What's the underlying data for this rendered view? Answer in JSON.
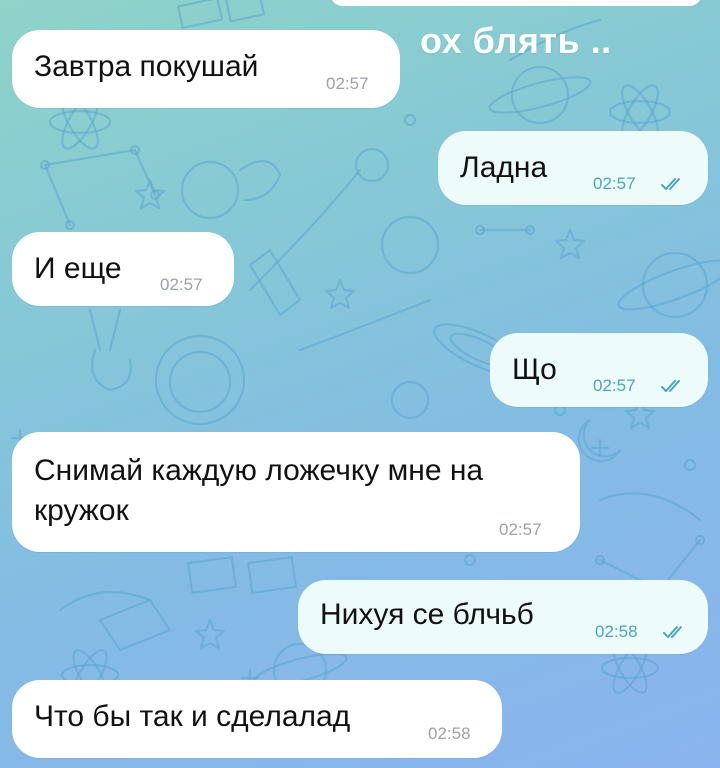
{
  "overlay_text": "ох блять ..",
  "messages": [
    {
      "direction": "incoming",
      "text": "Завтра покушай",
      "time": "02:57"
    },
    {
      "direction": "outgoing",
      "text": "Ладна",
      "time": "02:57",
      "status": "read"
    },
    {
      "direction": "incoming",
      "text": "И еще",
      "time": "02:57"
    },
    {
      "direction": "outgoing",
      "text": "Що",
      "time": "02:57",
      "status": "read"
    },
    {
      "direction": "incoming",
      "text_line1": "Снимай каждую ложечку мне на",
      "text_line2": "кружок",
      "time": "02:57"
    },
    {
      "direction": "outgoing",
      "text": "Нихуя се блчьб",
      "time": "02:58",
      "status": "read"
    },
    {
      "direction": "incoming",
      "text": "Что бы так и сделалад",
      "time": "02:58"
    }
  ],
  "colors": {
    "incoming_bubble": "#ffffff",
    "outgoing_bubble": "#edfbfb",
    "read_check": "#4aa6b8"
  },
  "icons": {
    "read_status": "double-check-icon"
  }
}
